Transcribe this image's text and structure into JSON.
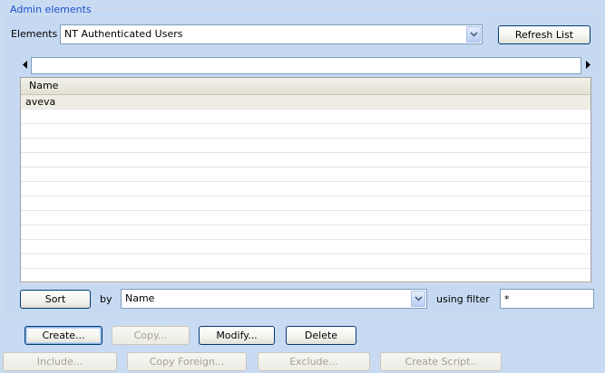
{
  "group": {
    "title": "Admin elements"
  },
  "elements": {
    "label": "Elements",
    "selected": "NT Authenticated Users",
    "refresh_label": "Refresh List"
  },
  "list": {
    "column_header": "Name",
    "rows": [
      "aveva",
      "",
      "",
      "",
      "",
      "",
      "",
      "",
      "",
      "",
      "",
      "",
      ""
    ],
    "selected_index": 0
  },
  "sort": {
    "button_label": "Sort",
    "by_label": "by",
    "by_selected": "Name",
    "filter_label": "using filter",
    "filter_value": "*"
  },
  "actions": {
    "create": "Create...",
    "copy": "Copy...",
    "modify": "Modify...",
    "delete": "Delete",
    "include": "Include...",
    "copy_foreign": "Copy Foreign...",
    "exclude": "Exclude...",
    "create_script": "Create Script.."
  },
  "icons": {
    "dropdown": "chevron-down-icon",
    "scroll_left": "arrow-left-icon",
    "scroll_right": "arrow-right-icon"
  }
}
